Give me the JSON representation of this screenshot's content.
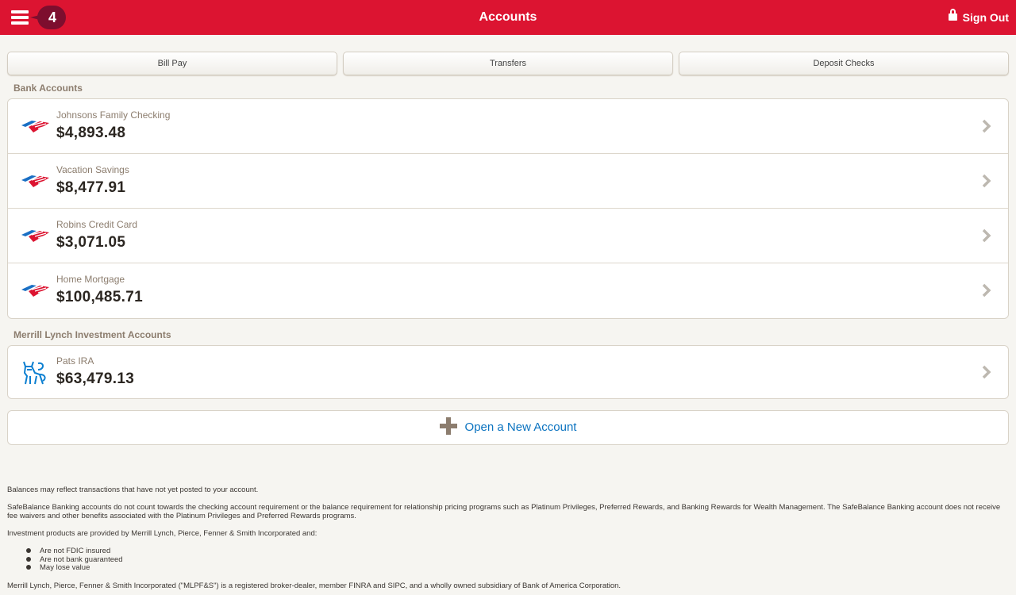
{
  "header": {
    "badge_count": "4",
    "title": "Accounts",
    "sign_out": "Sign Out"
  },
  "actions": [
    "Bill Pay",
    "Transfers",
    "Deposit Checks"
  ],
  "bank_section": "Bank Accounts",
  "bank_accounts": [
    {
      "name": "Johnsons Family Checking",
      "balance": "$4,893.48"
    },
    {
      "name": "Vacation Savings",
      "balance": "$8,477.91"
    },
    {
      "name": "Robins Credit Card",
      "balance": "$3,071.05"
    },
    {
      "name": "Home Mortgage",
      "balance": "$100,485.71"
    }
  ],
  "invest_section": "Merrill Lynch Investment Accounts",
  "invest_accounts": [
    {
      "name": "Pats IRA",
      "balance": "$63,479.13"
    }
  ],
  "open_account": "Open a New Account",
  "footer": {
    "p1": "Balances may reflect transactions that have not yet posted to your account.",
    "p2": "SafeBalance Banking accounts do not count towards the checking account requirement or the balance requirement for relationship pricing programs such as Platinum Privileges, Preferred Rewards, and Banking Rewards for Wealth Management. The SafeBalance Banking account does not receive fee waivers and other benefits associated with the Platinum Privileges and Preferred Rewards programs.",
    "p3": "Investment products are provided by Merrill Lynch, Pierce, Fenner & Smith Incorporated and:",
    "bullets": [
      "Are not FDIC insured",
      "Are not bank guaranteed",
      "May lose value"
    ],
    "p4": "Merrill Lynch, Pierce, Fenner & Smith Incorporated (\"MLPF&S\") is a registered broker-dealer, member FINRA and SIPC, and a wholly owned subsidiary of Bank of America Corporation."
  },
  "colors": {
    "header": "#dc1431",
    "badge": "#7d0e2e",
    "link": "#0b73c0"
  }
}
